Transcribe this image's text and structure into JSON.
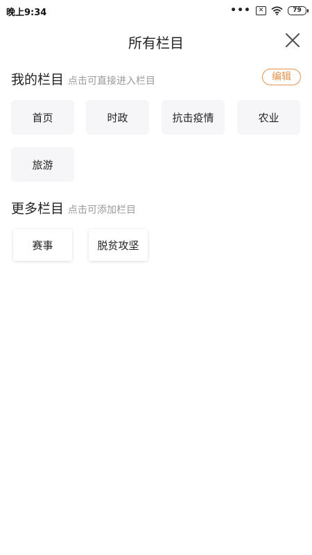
{
  "status_bar": {
    "time": "晚上9:34",
    "dots": "•••",
    "sim_label": "✕",
    "battery_level": "79"
  },
  "header": {
    "title": "所有栏目",
    "close_icon": "close-icon"
  },
  "my_columns": {
    "title": "我的栏目",
    "hint": "点击可直接进入栏目",
    "edit_label": "编辑",
    "items": [
      "首页",
      "时政",
      "抗击疫情",
      "农业",
      "旅游"
    ]
  },
  "more_columns": {
    "title": "更多栏目",
    "hint": "点击可添加栏目",
    "items": [
      "赛事",
      "脱贫攻坚"
    ]
  },
  "colors": {
    "accent": "#e5914a",
    "chip_bg": "#f6f6f8",
    "hint_text": "#999999"
  }
}
